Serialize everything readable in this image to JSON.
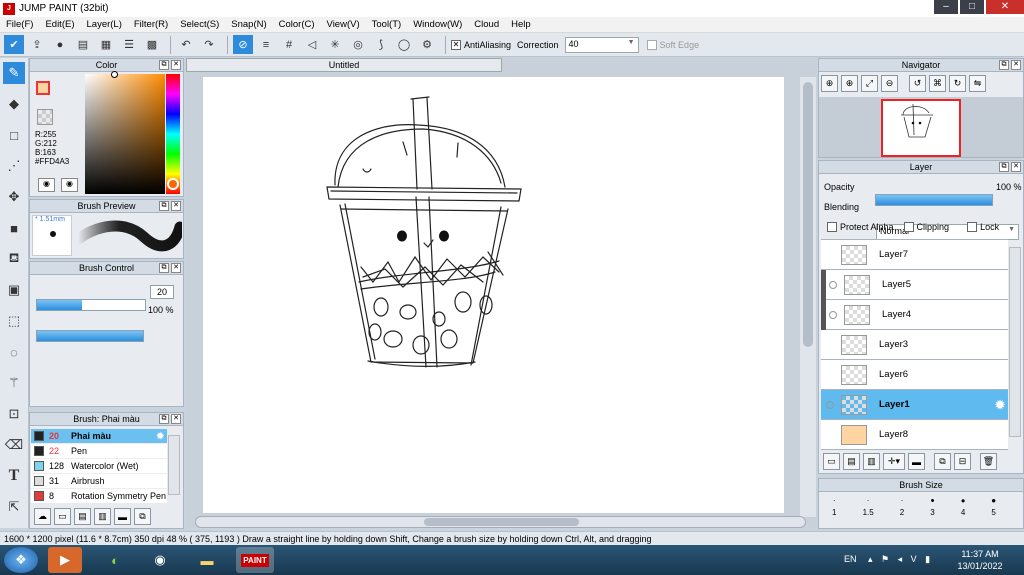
{
  "window": {
    "title": "JUMP PAINT (32bit)",
    "icon": "jump-paint-icon"
  },
  "menu": [
    "File(F)",
    "Edit(E)",
    "Layer(L)",
    "Filter(R)",
    "Select(S)",
    "Snap(N)",
    "Color(C)",
    "View(V)",
    "Tool(T)",
    "Window(W)",
    "Cloud",
    "Help"
  ],
  "toolbar": {
    "antialiasing_label": "AntiAliasing",
    "correction_label": "Correction",
    "correction_value": "40",
    "soft_edge_label": "Soft Edge"
  },
  "color_panel": {
    "title": "Color",
    "r": "R:255",
    "g": "G:212",
    "b": "B:163",
    "hex": "#FFD4A3",
    "fg_color": "#FFD4A3"
  },
  "brush_preview": {
    "title": "Brush Preview",
    "size": "1.51mm"
  },
  "brush_control": {
    "title": "Brush Control",
    "size_value": "20",
    "opacity_value": "100 %",
    "size_fraction": 0.42,
    "opacity_fraction": 1.0
  },
  "brush_list": {
    "title": "Brush: Phai màu",
    "items": [
      {
        "size": "20",
        "name": "Phai màu",
        "color": "#222222",
        "selected": true
      },
      {
        "size": "22",
        "name": "Pen",
        "color": "#222222"
      },
      {
        "size": "128",
        "name": "Watercolor (Wet)",
        "color": "#7fd3f0"
      },
      {
        "size": "31",
        "name": "Airbrush",
        "color": "#dddddd"
      },
      {
        "size": "8",
        "name": "Rotation Symmetry Pen",
        "color": "#e33b3b"
      }
    ]
  },
  "document": {
    "tab_title": "Untitled"
  },
  "navigator": {
    "title": "Navigator"
  },
  "layer_panel": {
    "title": "Layer",
    "opacity_label": "Opacity",
    "opacity_value": "100 %",
    "blending_label": "Blending",
    "blending_value": "Normal",
    "protect_alpha": "Protect Alpha",
    "clipping": "Clipping",
    "lock": "Lock",
    "layers": [
      {
        "name": "Layer7"
      },
      {
        "name": "Layer5",
        "clipped": true
      },
      {
        "name": "Layer4",
        "clipped": true
      },
      {
        "name": "Layer3"
      },
      {
        "name": "Layer6"
      },
      {
        "name": "Layer1",
        "selected": true
      },
      {
        "name": "Layer8",
        "fill": "#FFD4A3"
      }
    ]
  },
  "brush_size_panel": {
    "title": "Brush Size",
    "sizes": [
      "1",
      "1.5",
      "2",
      "3",
      "4",
      "5"
    ]
  },
  "status": "1600 * 1200 pixel   (11.6 * 8.7cm)   350 dpi   48 %   ( 375, 1193 )   Draw a straight line by holding down Shift, Change a brush size by holding down Ctrl, Alt, and dragging",
  "tray": {
    "lang": "EN",
    "time": "11:37 AM",
    "date": "13/01/2022"
  }
}
